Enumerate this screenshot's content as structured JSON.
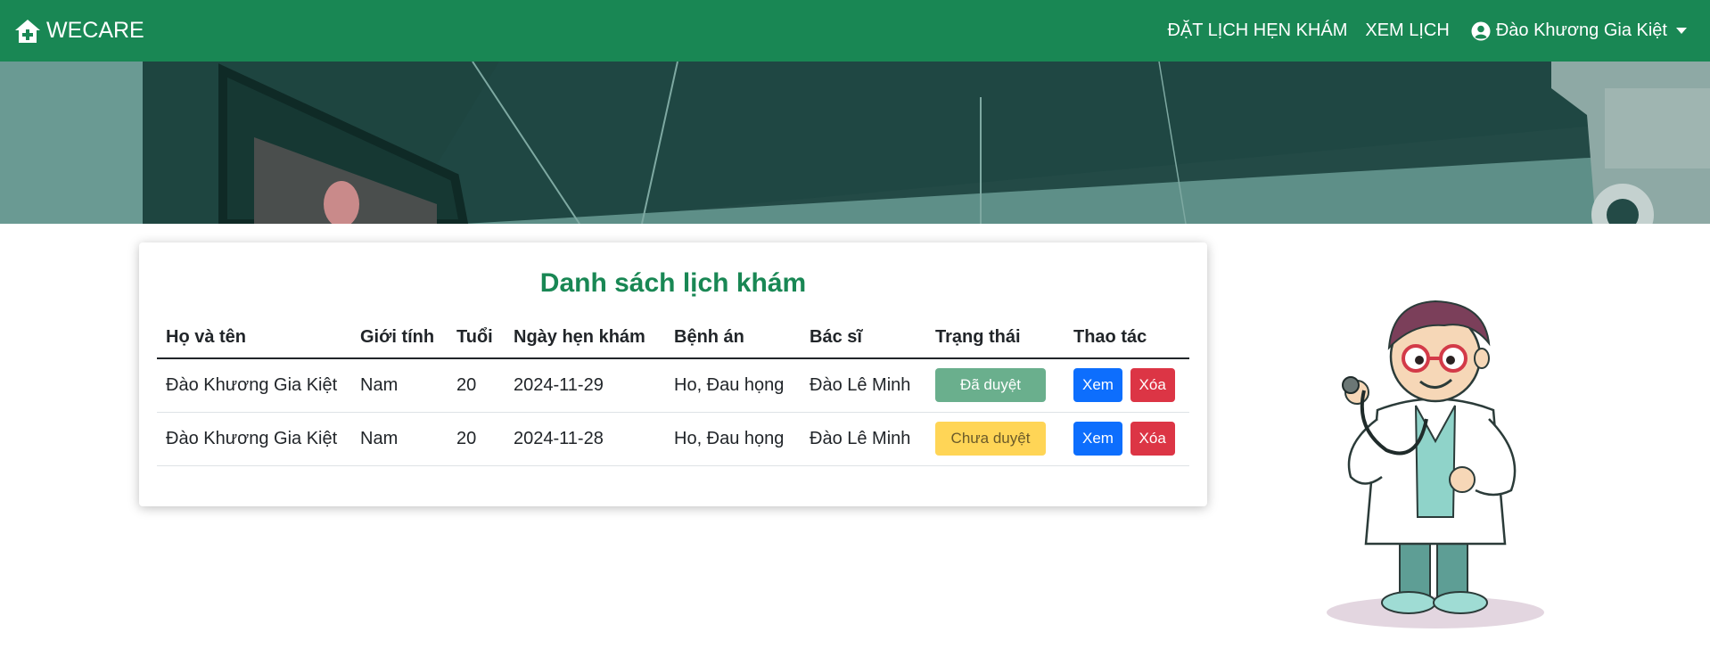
{
  "navbar": {
    "brand": "WECARE",
    "links": [
      "ĐẶT LỊCH HẸN KHÁM",
      "XEM LỊCH"
    ],
    "user_name": "Đào Khương Gia Kiệt",
    "bg_color": "#198754"
  },
  "main": {
    "title": "Danh sách lịch khám",
    "columns": [
      "Họ và tên",
      "Giới tính",
      "Tuổi",
      "Ngày hẹn khám",
      "Bệnh án",
      "Bác sĩ",
      "Trạng thái",
      "Thao tác"
    ],
    "rows": [
      {
        "name": "Đào Khương Gia Kiệt",
        "gender": "Nam",
        "age": "20",
        "date": "2024-11-29",
        "diagnosis": "Ho, Đau họng",
        "doctor": "Đào Lê Minh",
        "status": "Đã duyệt",
        "status_color": "#6aaf8d",
        "view_label": "Xem",
        "delete_label": "Xóa"
      },
      {
        "name": "Đào Khương Gia Kiệt",
        "gender": "Nam",
        "age": "20",
        "date": "2024-11-28",
        "diagnosis": "Ho, Đau họng",
        "doctor": "Đào Lê Minh",
        "status": "Chưa duyệt",
        "status_color": "#ffd556",
        "view_label": "Xem",
        "delete_label": "Xóa"
      }
    ]
  },
  "icons": {
    "brand": "house-medical-icon",
    "user": "user-circle-icon",
    "dropdown": "caret-down-icon"
  }
}
